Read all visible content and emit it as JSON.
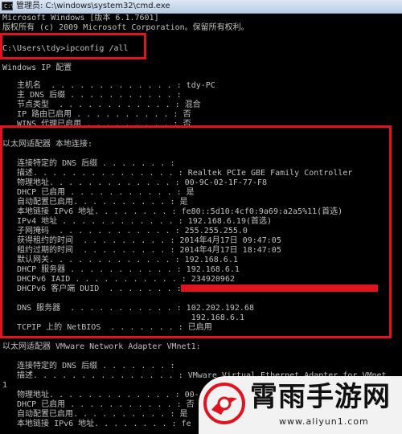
{
  "window": {
    "icon_text": "C:\\",
    "title": "管理员: C:\\windows\\system32\\cmd.exe"
  },
  "console_lines": [
    "Microsoft Windows [版本 6.1.7601]",
    "版权所有 (c) 2009 Microsoft Corporation。保留所有权利。",
    "",
    "C:\\Users\\tdy>ipconfig /all",
    "",
    "Windows IP 配置",
    "",
    "   主机名  . . . . . . . . . . . . . : tdy-PC",
    "   主 DNS 后缀 . . . . . . . . . . . :",
    "   节点类型  . . . . . . . . . . . . : 混合",
    "   IP 路由已启用 . . . . . . . . . . : 否",
    "   WINS 代理已启用 . . . . . . . . . : 否",
    "",
    "以太网适配器 本地连接:",
    "",
    "   连接特定的 DNS 后缀 . . . . . . . :",
    "   描述. . . . . . . . . . . . . . . : Realtek PCIe GBE Family Controller",
    "   物理地址. . . . . . . . . . . . . : 00-9C-02-1F-77-F8",
    "   DHCP 已启用 . . . . . . . . . . . : 是",
    "   自动配置已启用. . . . . . . . . . : 是",
    "   本地链接 IPv6 地址. . . . . . . . : fe80::5d10:4cf0:9a69:a2a5%11(首选)",
    "   IPv4 地址 . . . . . . . . . . . . : 192.168.6.19(首选)",
    "   子网掩码  . . . . . . . . . . . . : 255.255.255.0",
    "   获得租约的时间  . . . . . . . . . : 2014年4月17日 09:47:05",
    "   租约过期的时间  . . . . . . . . . : 2014年4月17日 18:47:05",
    "   默认网关. . . . . . . . . . . . . : 192.168.6.1",
    "   DHCP 服务器 . . . . . . . . . . . : 192.168.6.1",
    "   DHCPv6 IAID . . . . . . . . . . . : 234920962",
    "   DHCPv6 客户端 DUID  . . . . . . . :",
    "",
    "   DNS 服务器  . . . . . . . . . . . : 102.202.192.68",
    "                                       192.168.6.1",
    "   TCPIP 上的 NetBIOS  . . . . . . . : 已启用",
    "",
    "以太网适配器 VMware Network Adapter VMnet1:",
    "",
    "   连接特定的 DNS 后缀 . . . . . . . :",
    "   描述. . . . . . . . . . . . . . . : VMware Virtual Ethernet Adapter for VMnet",
    "1",
    "   物理地址. . . . . . . . . . . . . : 00-",
    "   DHCP 已启用 . . . . . . . . . . . : 否",
    "   自动配置已启用. . . . . . . . . . : 是",
    "   本地链接 IPv6 地址. . . . . . . . : fe"
  ],
  "watermark": {
    "brand": "霄雨手游网",
    "url": "www.aliyun1.com"
  },
  "colors": {
    "console_text": "#c0c0c0",
    "console_bg": "#000000",
    "highlight": "#e0141e"
  }
}
